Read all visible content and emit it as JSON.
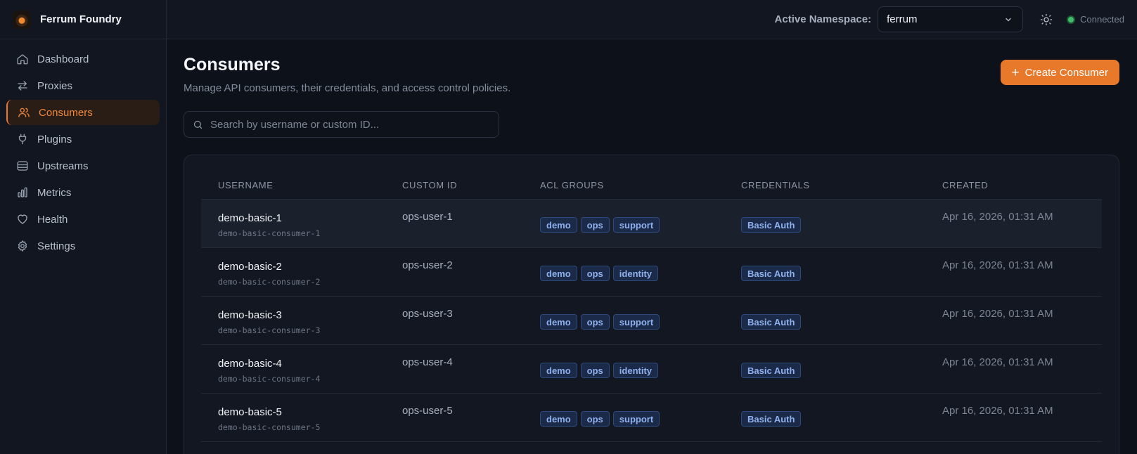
{
  "brand": {
    "name": "Ferrum Foundry"
  },
  "sidebar": {
    "items": [
      {
        "label": "Dashboard",
        "icon": "home-icon"
      },
      {
        "label": "Proxies",
        "icon": "arrows-swap-icon"
      },
      {
        "label": "Consumers",
        "icon": "users-icon",
        "active": true
      },
      {
        "label": "Plugins",
        "icon": "plugin-icon"
      },
      {
        "label": "Upstreams",
        "icon": "database-icon"
      },
      {
        "label": "Metrics",
        "icon": "bar-chart-icon"
      },
      {
        "label": "Health",
        "icon": "heart-icon"
      },
      {
        "label": "Settings",
        "icon": "gear-icon"
      }
    ]
  },
  "topbar": {
    "namespace_label": "Active Namespace:",
    "namespace_value": "ferrum",
    "status_text": "Connected",
    "status_color": "#3dbd6a"
  },
  "page": {
    "title": "Consumers",
    "subtitle": "Manage API consumers, their credentials, and access control policies.",
    "create_label": "Create Consumer",
    "accent": "#e8782a"
  },
  "search": {
    "placeholder": "Search by username or custom ID..."
  },
  "table": {
    "columns": [
      "USERNAME",
      "CUSTOM ID",
      "ACL GROUPS",
      "CREDENTIALS",
      "CREATED"
    ],
    "rows": [
      {
        "username": "demo-basic-1",
        "sub": "demo-basic-consumer-1",
        "custom_id": "ops-user-1",
        "acl": [
          "demo",
          "ops",
          "support"
        ],
        "credential": "Basic Auth",
        "created": "Apr 16, 2026, 01:31 AM"
      },
      {
        "username": "demo-basic-2",
        "sub": "demo-basic-consumer-2",
        "custom_id": "ops-user-2",
        "acl": [
          "demo",
          "ops",
          "identity"
        ],
        "credential": "Basic Auth",
        "created": "Apr 16, 2026, 01:31 AM"
      },
      {
        "username": "demo-basic-3",
        "sub": "demo-basic-consumer-3",
        "custom_id": "ops-user-3",
        "acl": [
          "demo",
          "ops",
          "support"
        ],
        "credential": "Basic Auth",
        "created": "Apr 16, 2026, 01:31 AM"
      },
      {
        "username": "demo-basic-4",
        "sub": "demo-basic-consumer-4",
        "custom_id": "ops-user-4",
        "acl": [
          "demo",
          "ops",
          "identity"
        ],
        "credential": "Basic Auth",
        "created": "Apr 16, 2026, 01:31 AM"
      },
      {
        "username": "demo-basic-5",
        "sub": "demo-basic-consumer-5",
        "custom_id": "ops-user-5",
        "acl": [
          "demo",
          "ops",
          "support"
        ],
        "credential": "Basic Auth",
        "created": "Apr 16, 2026, 01:31 AM"
      }
    ]
  }
}
